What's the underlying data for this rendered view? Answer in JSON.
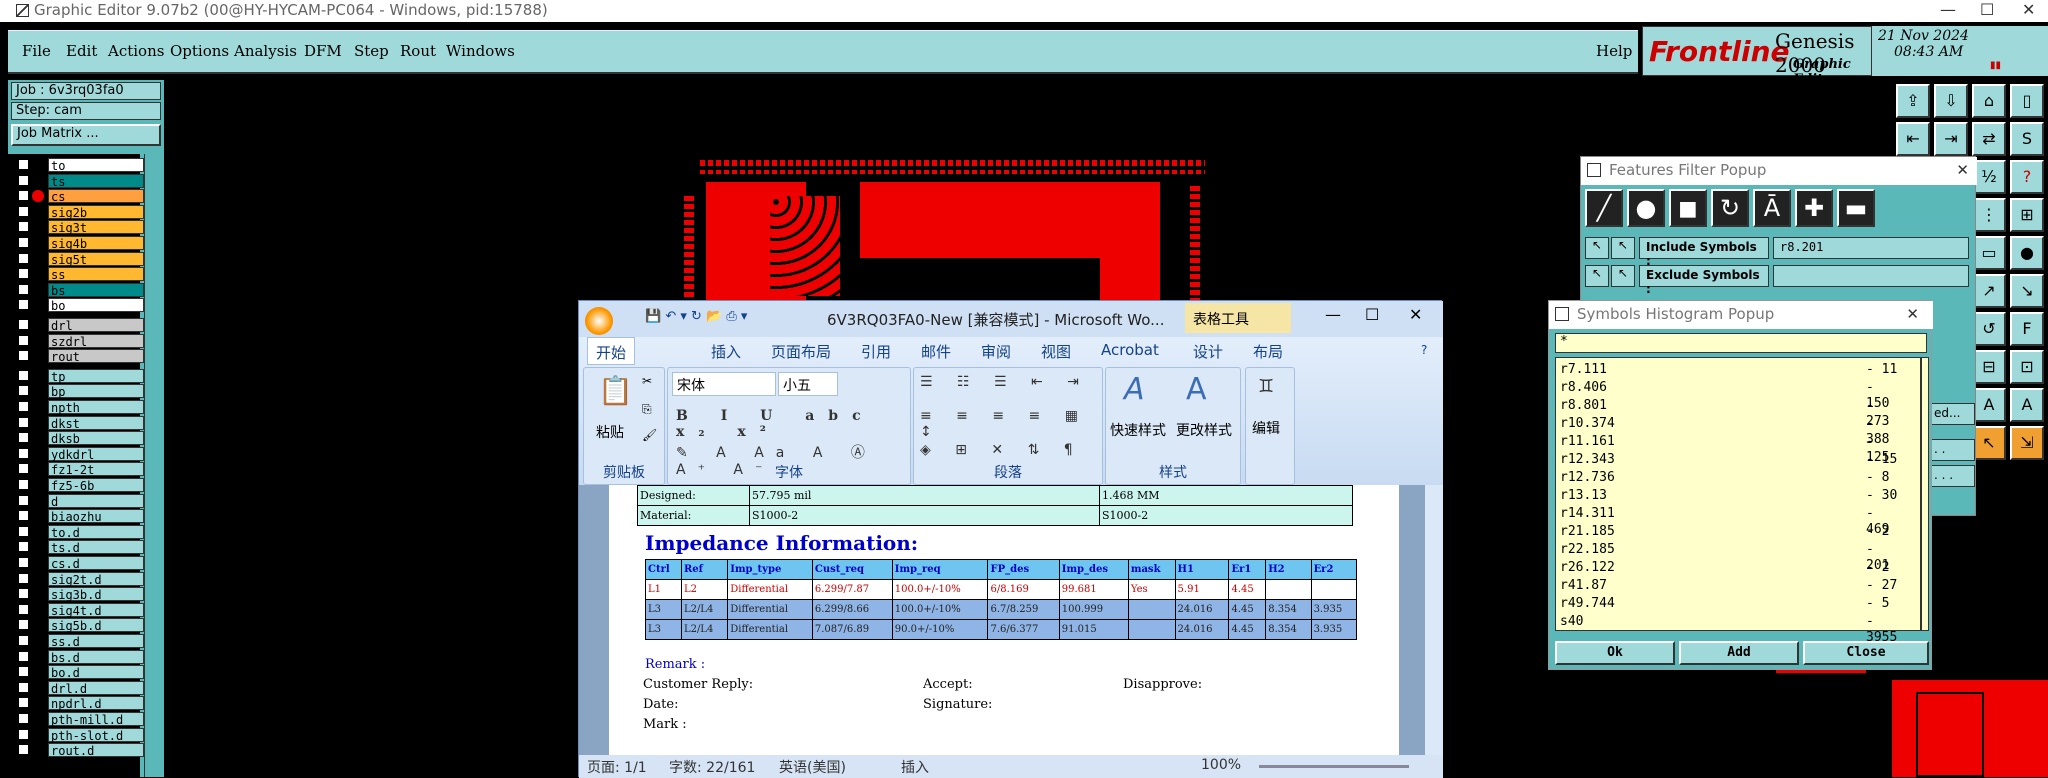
{
  "window_title": "Graphic Editor 9.07b2 (00@HY-HYCAM-PC064 - Windows, pid:15788)",
  "menu": [
    "File",
    "Edit",
    "Actions",
    "Options",
    "Analysis",
    "DFM",
    "Step",
    "Rout",
    "Windows"
  ],
  "help": "Help",
  "brand": {
    "logo": "Frontline",
    "product": "Genesis 2000",
    "sub": "Graphic Editor"
  },
  "clock": {
    "date": "21 Nov 2024",
    "time": "08:43 AM"
  },
  "job": {
    "job": "Job : 6v3rq03fa0",
    "step": "Step: cam",
    "matrix": "Job Matrix ..."
  },
  "layers_board": [
    {
      "name": "to",
      "color": "#ffffff"
    },
    {
      "name": "ts",
      "color": "#008b8b"
    },
    {
      "name": "cs",
      "color": "#ffa040",
      "active": true
    },
    {
      "name": "sig2b",
      "color": "#ffb830"
    },
    {
      "name": "sig3t",
      "color": "#ffb830"
    },
    {
      "name": "sig4b",
      "color": "#ffb830"
    },
    {
      "name": "sig5t",
      "color": "#ffb830"
    },
    {
      "name": "ss",
      "color": "#ffb830"
    },
    {
      "name": "bs",
      "color": "#008b8b"
    },
    {
      "name": "bo",
      "color": "#ffffff"
    }
  ],
  "layers_drill": [
    {
      "name": "drl",
      "color": "#c8c8c8"
    },
    {
      "name": "szdrl",
      "color": "#c8c8c8"
    },
    {
      "name": "rout",
      "color": "#c8c8c8"
    }
  ],
  "layers_misc": [
    "tp",
    "bp",
    "npth",
    "dkst",
    "dksb",
    "ydkdrl",
    "fz1-2t",
    "fz5-6b",
    "d",
    "biaozhu",
    "to.d",
    "ts.d",
    "cs.d",
    "sig2t.d",
    "sig3b.d",
    "sig4t.d",
    "sig5b.d",
    "ss.d",
    "bs.d",
    "bo.d",
    "drl.d",
    "npdrl.d",
    "pth-mill.d",
    "pth-slot.d",
    "rout.d"
  ],
  "features_filter": {
    "title": "Features Filter Popup",
    "include_label": "Include Symbols :",
    "include_value": "r8.201",
    "exclude_label": "Exclude Symbols :",
    "exclude_value": "",
    "side_labels": [
      "ed...",
      ". .",
      ". . ."
    ]
  },
  "histogram": {
    "title": "Symbols Histogram Popup",
    "filter": "*",
    "rows": [
      {
        "sym": "r7.111",
        "count": "- 11"
      },
      {
        "sym": "r8.406",
        "count": "- 150"
      },
      {
        "sym": "r8.801",
        "count": "- 273"
      },
      {
        "sym": "r10.374",
        "count": "- 388"
      },
      {
        "sym": "r11.161",
        "count": "- 125"
      },
      {
        "sym": "r12.343",
        "count": "- 15"
      },
      {
        "sym": "r12.736",
        "count": "- 8"
      },
      {
        "sym": "r13.13",
        "count": "- 30"
      },
      {
        "sym": "r14.311",
        "count": "- 469"
      },
      {
        "sym": "r21.185",
        "count": "- 2"
      },
      {
        "sym": "r22.185",
        "count": "- 201"
      },
      {
        "sym": "r26.122",
        "count": "- 2"
      },
      {
        "sym": "r41.87",
        "count": "- 27"
      },
      {
        "sym": "r49.744",
        "count": "- 5"
      },
      {
        "sym": "s40",
        "count": "- 3955"
      }
    ],
    "ok": "Ok",
    "add": "Add",
    "close": "Close"
  },
  "word": {
    "title": "6V3RQ03FA0-New [兼容模式] - Microsoft Wo...",
    "context_tab": "表格工具",
    "tabs": [
      "开始",
      "插入",
      "页面布局",
      "引用",
      "邮件",
      "审阅",
      "视图",
      "Acrobat",
      "设计",
      "布局"
    ],
    "font_name": "宋体",
    "font_size": "小五",
    "paste": "粘贴",
    "quick_style": "快速样式",
    "change_style": "更改样式",
    "edit": "编辑",
    "groups": [
      "剪贴板",
      "字体",
      "段落",
      "样式"
    ],
    "doc": {
      "designed_label": "Designed:",
      "designed_mil": "57.795 mil",
      "designed_mm": "1.468 MM",
      "material_label": "Material:",
      "material_1": "S1000-2",
      "material_2": "S1000-2",
      "impedance_heading": "Impedance Information:",
      "imp_headers": [
        "Ctrl",
        "Ref",
        "Imp_type",
        "Cust_req",
        "Imp_req",
        "FP_des",
        "Imp_des",
        "mask",
        "H1",
        "Er1",
        "H2",
        "Er2"
      ],
      "imp_rows": [
        [
          "L1",
          "L2",
          "Differential",
          "6.299/7.87",
          "100.0+/-10%",
          "6/8.169",
          "99.681",
          "Yes",
          "5.91",
          "4.45",
          "",
          ""
        ],
        [
          "L3",
          "L2/L4",
          "Differential",
          "6.299/8.66",
          "100.0+/-10%",
          "6.7/8.259",
          "100.999",
          "",
          "24.016",
          "4.45",
          "8.354",
          "3.935"
        ],
        [
          "L3",
          "L2/L4",
          "Differential",
          "7.087/6.89",
          "90.0+/-10%",
          "7.6/6.377",
          "91.015",
          "",
          "24.016",
          "4.45",
          "8.354",
          "3.935"
        ]
      ],
      "remark": "Remark :",
      "customer_reply": "Customer Reply:",
      "accept": "Accept:",
      "disapprove": "Disapprove:",
      "date": "Date:",
      "signature": "Signature:",
      "mark": "Mark :"
    },
    "status": {
      "page": "页面: 1/1",
      "words": "字数: 22/161",
      "lang": "英语(美国)",
      "mode": "插入",
      "zoom": "100%"
    }
  }
}
